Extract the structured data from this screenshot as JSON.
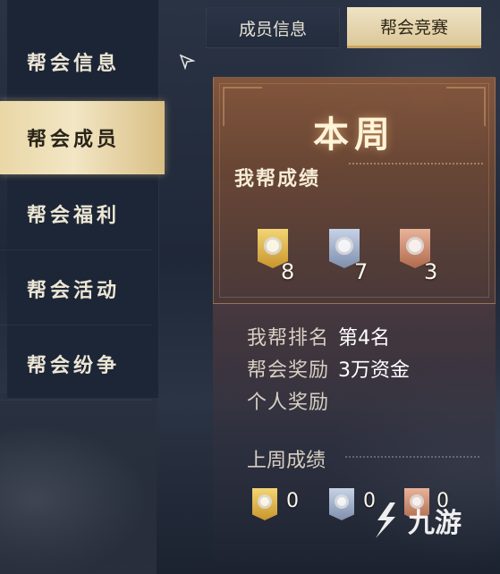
{
  "sidebar": {
    "items": [
      {
        "label": "帮会信息",
        "active": false
      },
      {
        "label": "帮会成员",
        "active": true
      },
      {
        "label": "帮会福利",
        "active": false
      },
      {
        "label": "帮会活动",
        "active": false
      },
      {
        "label": "帮会纷争",
        "active": false
      }
    ]
  },
  "tabs": {
    "members": "成员信息",
    "contest": "帮会竞赛"
  },
  "panel": {
    "title": "本周",
    "section_title": "我帮成绩",
    "medals": {
      "gold": "8",
      "silver": "7",
      "bronze": "3"
    },
    "rank_label": "我帮排名",
    "rank_value": "第4名",
    "guild_reward_label": "帮会奖励",
    "guild_reward_value": "3万资金",
    "personal_reward_label": "个人奖励",
    "personal_reward_value": "",
    "last_week_title": "上周成绩",
    "last_week_medals": {
      "gold": "0",
      "silver": "0",
      "bronze": "0"
    }
  },
  "watermark": {
    "text": "九游"
  },
  "colors": {
    "active_tab": "#efe3c4",
    "panel": "#8c5a3c",
    "gold": "#e0b54a",
    "silver": "#9fb0cc",
    "bronze": "#cf8b6c"
  }
}
